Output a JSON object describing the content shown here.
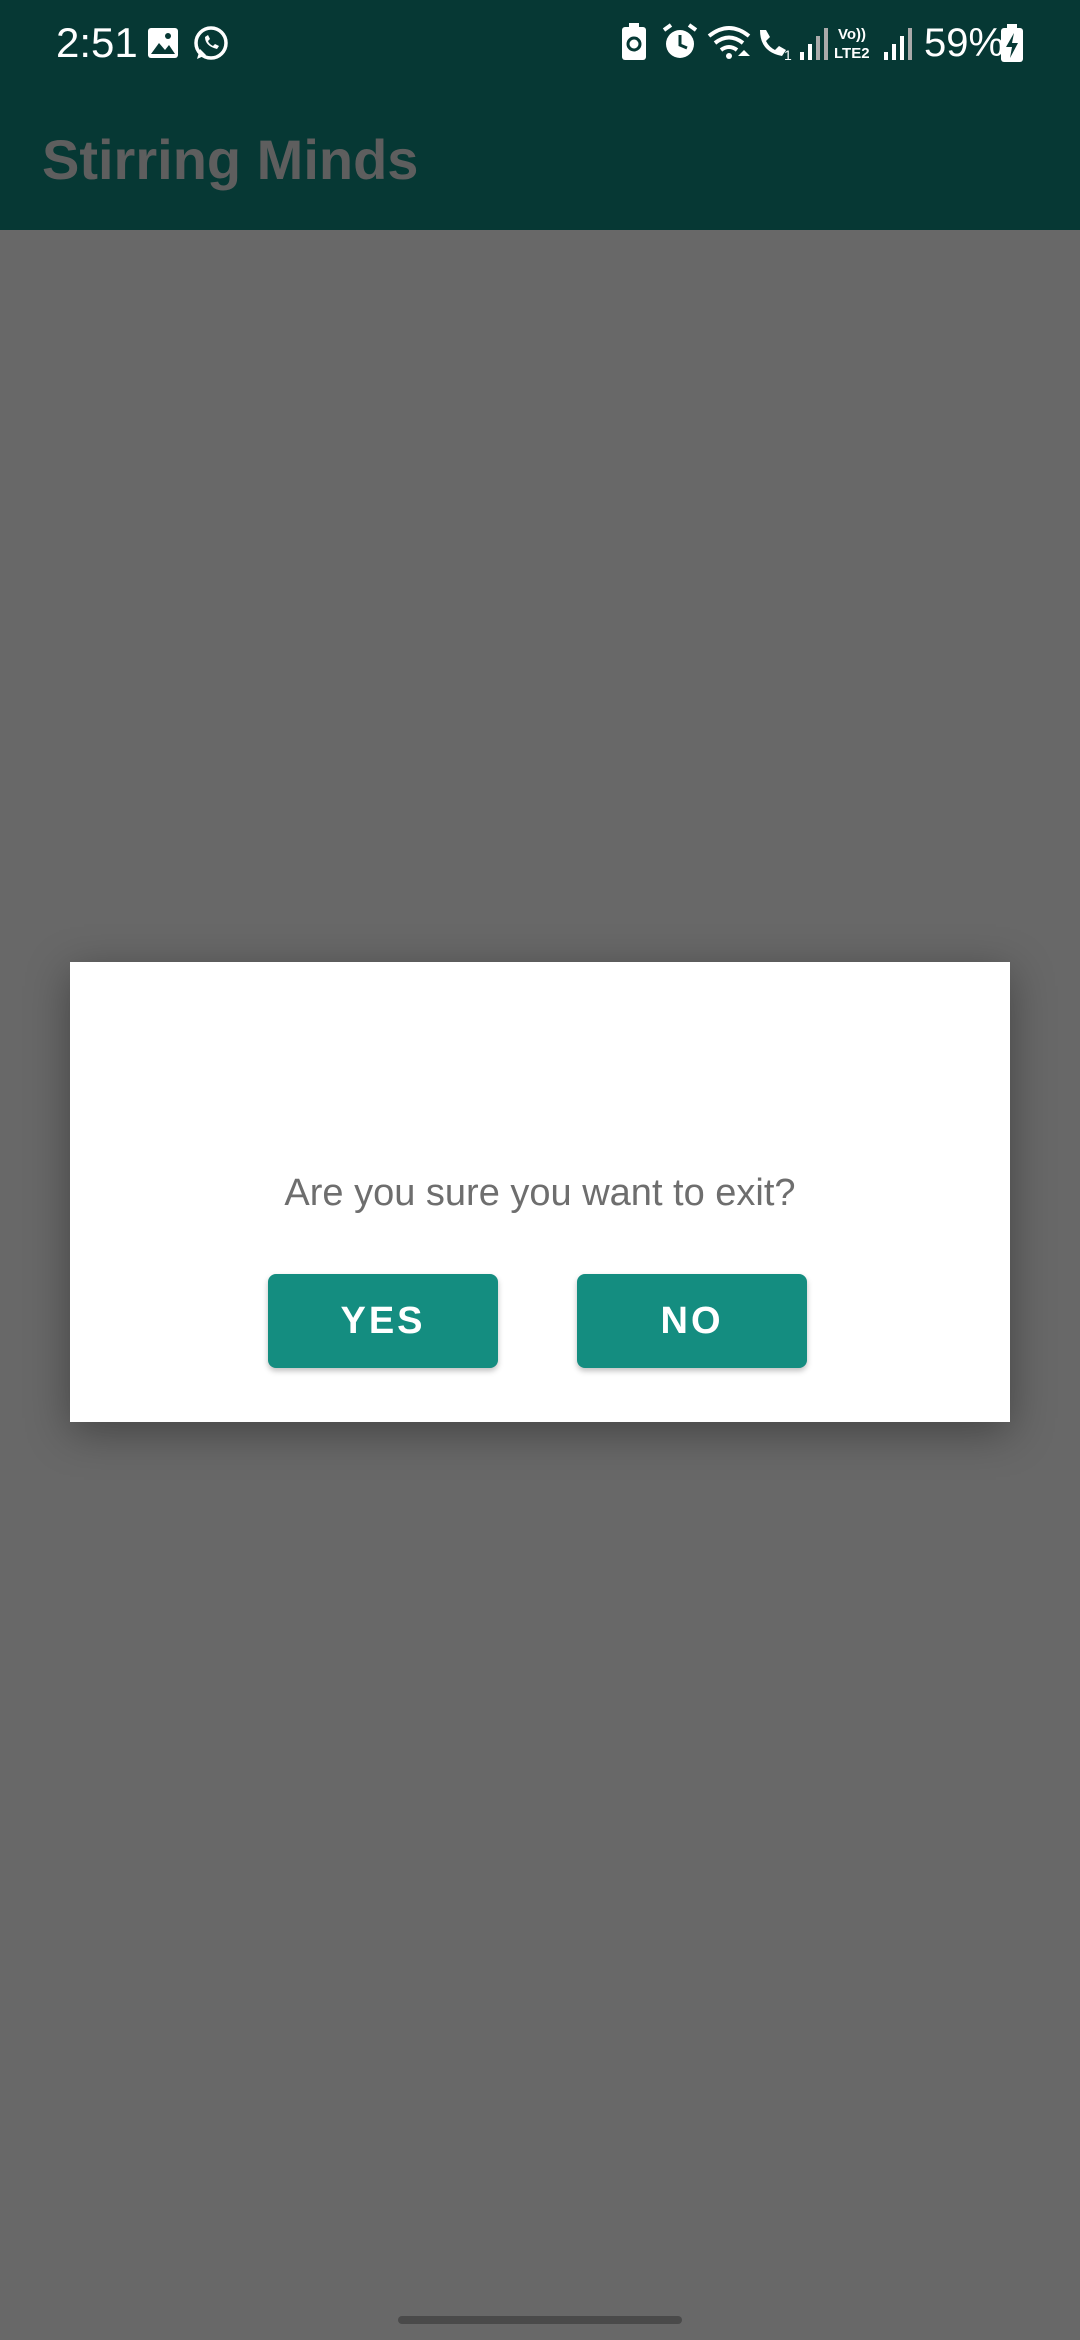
{
  "status_bar": {
    "time": "2:51",
    "battery": "59%",
    "icons": [
      "image-icon",
      "whatsapp-icon",
      "battery-saver-icon",
      "alarm-icon",
      "wifi-icon",
      "wifi-call-icon",
      "signal-icon",
      "volte-lte2-icon",
      "signal-icon",
      "battery-charging-icon"
    ],
    "lte_label": "Vo)) LTE2"
  },
  "app_bar": {
    "title": "Stirring Minds"
  },
  "dialog": {
    "message": "Are you sure you want to exit?",
    "yes_label": "YES",
    "no_label": "NO"
  },
  "colors": {
    "app_bar": "#063834",
    "button": "#148d80",
    "scrim": "#686868",
    "dialog_bg": "#ffffff"
  }
}
